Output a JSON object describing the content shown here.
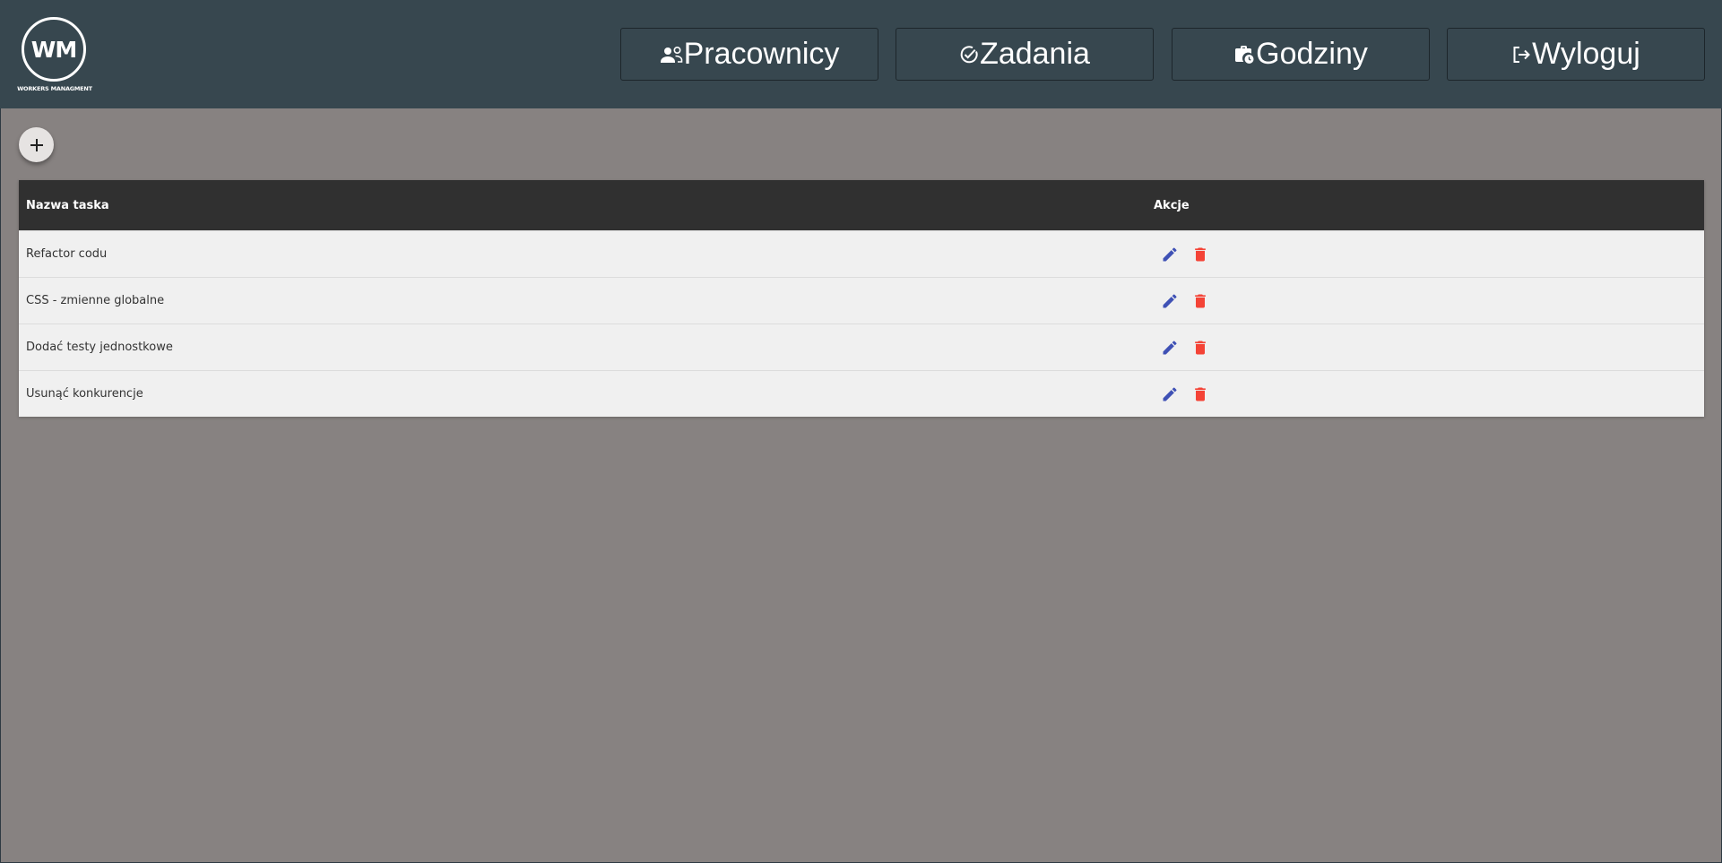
{
  "brand": {
    "logo_text": "WM",
    "logo_subtitle": "WORKERS MANAGMENT"
  },
  "nav": {
    "pracownicy": {
      "label": "Pracownicy",
      "icon": "people-icon"
    },
    "zadania": {
      "label": "Zadania",
      "icon": "check-circle-icon"
    },
    "godziny": {
      "label": "Godziny",
      "icon": "work-history-icon"
    },
    "wyloguj": {
      "label": "Wyloguj",
      "icon": "logout-icon"
    }
  },
  "add_button": {
    "icon": "plus-icon"
  },
  "table": {
    "headers": {
      "name": "Nazwa taska",
      "actions": "Akcje"
    },
    "rows": [
      {
        "name": "Refactor codu"
      },
      {
        "name": "CSS - zmienne globalne"
      },
      {
        "name": "Dodać testy jednostkowe"
      },
      {
        "name": "Usunąć konkurencje"
      }
    ]
  },
  "colors": {
    "header_bg": "#37474f",
    "page_bg": "#878281",
    "table_header_bg": "#303030",
    "row_bg": "#f0f0f0",
    "edit_icon": "#3f51b5",
    "delete_icon": "#f44336"
  }
}
